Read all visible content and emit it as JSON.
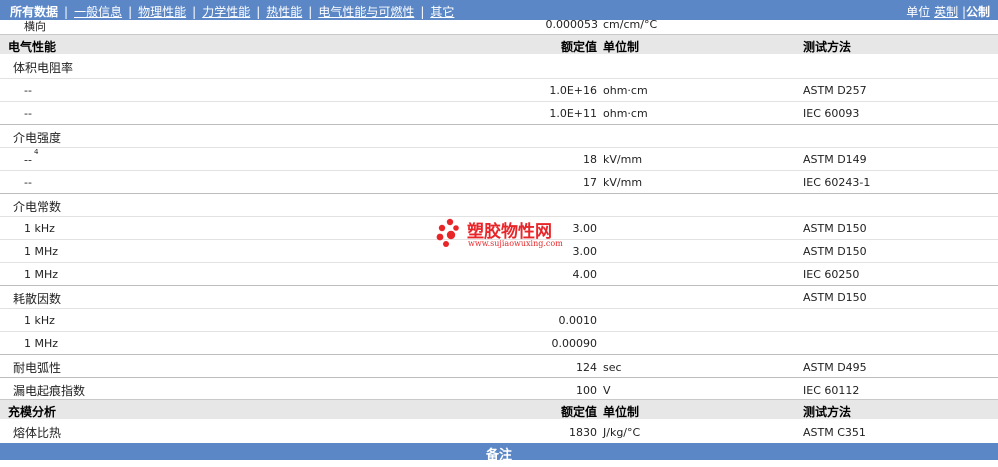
{
  "nav": {
    "items": [
      "所有数据",
      "一般信息",
      "物理性能",
      "力学性能",
      "热性能",
      "电气性能与可燃性",
      "其它"
    ],
    "unit_label": "单位",
    "unit_imperial": "英制",
    "unit_separator": "|",
    "unit_metric": "公制"
  },
  "prev_row": {
    "name": "横向",
    "value": "0.000053",
    "unit": "cm/cm/°C"
  },
  "headers": {
    "value": "额定值",
    "unit": "单位制",
    "test": "测试方法"
  },
  "electrical": {
    "title": "电气性能",
    "groups": [
      {
        "name": "体积电阻率",
        "rows": [
          {
            "name": "--",
            "value": "1.0E+16",
            "unit": "ohm·cm",
            "test": "ASTM D257"
          },
          {
            "name": "--",
            "value": "1.0E+11",
            "unit": "ohm·cm",
            "test": "IEC 60093"
          }
        ]
      },
      {
        "name": "介电强度",
        "rows": [
          {
            "name": "--",
            "sup": "4",
            "value": "18",
            "unit": "kV/mm",
            "test": "ASTM D149"
          },
          {
            "name": "--",
            "value": "17",
            "unit": "kV/mm",
            "test": "IEC 60243-1"
          }
        ]
      },
      {
        "name": "介电常数",
        "rows": [
          {
            "name": "1 kHz",
            "value": "3.00",
            "unit": "",
            "test": "ASTM D150"
          },
          {
            "name": "1 MHz",
            "value": "3.00",
            "unit": "",
            "test": "ASTM D150"
          },
          {
            "name": "1 MHz",
            "value": "4.00",
            "unit": "",
            "test": "IEC 60250"
          }
        ]
      },
      {
        "name": "耗散因数",
        "test": "ASTM D150",
        "rows": [
          {
            "name": "1 kHz",
            "value": "0.0010",
            "unit": "",
            "test": ""
          },
          {
            "name": "1 MHz",
            "value": "0.00090",
            "unit": "",
            "test": ""
          }
        ]
      }
    ],
    "singles": [
      {
        "name": "耐电弧性",
        "value": "124",
        "unit": "sec",
        "test": "ASTM D495"
      },
      {
        "name": "漏电起痕指数",
        "value": "100",
        "unit": "V",
        "test": "IEC 60112"
      }
    ]
  },
  "filling": {
    "title": "充模分析",
    "rows": [
      {
        "name": "熔体比热",
        "value": "1830",
        "unit": "J/kg/°C",
        "test": "ASTM C351"
      }
    ]
  },
  "notes": {
    "title": "备注"
  },
  "watermark": {
    "brand": "塑胶物性网",
    "url": "www.sujiaowuxing.com",
    "color": "#e8262a"
  },
  "colors": {
    "nav_bg": "#5b87c7",
    "section_bg": "#e7e7e7"
  }
}
